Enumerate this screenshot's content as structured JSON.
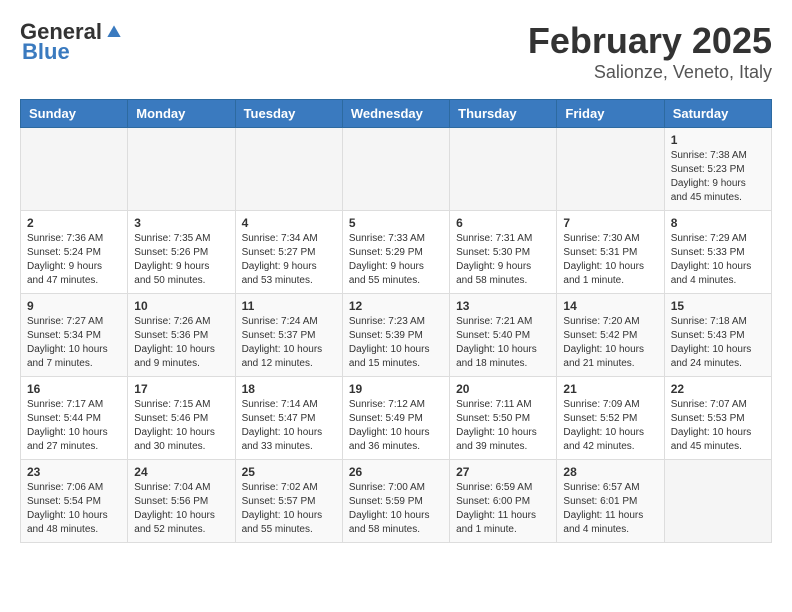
{
  "header": {
    "logo_general": "General",
    "logo_blue": "Blue",
    "month_title": "February 2025",
    "location": "Salionze, Veneto, Italy"
  },
  "days_of_week": [
    "Sunday",
    "Monday",
    "Tuesday",
    "Wednesday",
    "Thursday",
    "Friday",
    "Saturday"
  ],
  "weeks": [
    [
      {
        "day": "",
        "info": ""
      },
      {
        "day": "",
        "info": ""
      },
      {
        "day": "",
        "info": ""
      },
      {
        "day": "",
        "info": ""
      },
      {
        "day": "",
        "info": ""
      },
      {
        "day": "",
        "info": ""
      },
      {
        "day": "1",
        "info": "Sunrise: 7:38 AM\nSunset: 5:23 PM\nDaylight: 9 hours and 45 minutes."
      }
    ],
    [
      {
        "day": "2",
        "info": "Sunrise: 7:36 AM\nSunset: 5:24 PM\nDaylight: 9 hours and 47 minutes."
      },
      {
        "day": "3",
        "info": "Sunrise: 7:35 AM\nSunset: 5:26 PM\nDaylight: 9 hours and 50 minutes."
      },
      {
        "day": "4",
        "info": "Sunrise: 7:34 AM\nSunset: 5:27 PM\nDaylight: 9 hours and 53 minutes."
      },
      {
        "day": "5",
        "info": "Sunrise: 7:33 AM\nSunset: 5:29 PM\nDaylight: 9 hours and 55 minutes."
      },
      {
        "day": "6",
        "info": "Sunrise: 7:31 AM\nSunset: 5:30 PM\nDaylight: 9 hours and 58 minutes."
      },
      {
        "day": "7",
        "info": "Sunrise: 7:30 AM\nSunset: 5:31 PM\nDaylight: 10 hours and 1 minute."
      },
      {
        "day": "8",
        "info": "Sunrise: 7:29 AM\nSunset: 5:33 PM\nDaylight: 10 hours and 4 minutes."
      }
    ],
    [
      {
        "day": "9",
        "info": "Sunrise: 7:27 AM\nSunset: 5:34 PM\nDaylight: 10 hours and 7 minutes."
      },
      {
        "day": "10",
        "info": "Sunrise: 7:26 AM\nSunset: 5:36 PM\nDaylight: 10 hours and 9 minutes."
      },
      {
        "day": "11",
        "info": "Sunrise: 7:24 AM\nSunset: 5:37 PM\nDaylight: 10 hours and 12 minutes."
      },
      {
        "day": "12",
        "info": "Sunrise: 7:23 AM\nSunset: 5:39 PM\nDaylight: 10 hours and 15 minutes."
      },
      {
        "day": "13",
        "info": "Sunrise: 7:21 AM\nSunset: 5:40 PM\nDaylight: 10 hours and 18 minutes."
      },
      {
        "day": "14",
        "info": "Sunrise: 7:20 AM\nSunset: 5:42 PM\nDaylight: 10 hours and 21 minutes."
      },
      {
        "day": "15",
        "info": "Sunrise: 7:18 AM\nSunset: 5:43 PM\nDaylight: 10 hours and 24 minutes."
      }
    ],
    [
      {
        "day": "16",
        "info": "Sunrise: 7:17 AM\nSunset: 5:44 PM\nDaylight: 10 hours and 27 minutes."
      },
      {
        "day": "17",
        "info": "Sunrise: 7:15 AM\nSunset: 5:46 PM\nDaylight: 10 hours and 30 minutes."
      },
      {
        "day": "18",
        "info": "Sunrise: 7:14 AM\nSunset: 5:47 PM\nDaylight: 10 hours and 33 minutes."
      },
      {
        "day": "19",
        "info": "Sunrise: 7:12 AM\nSunset: 5:49 PM\nDaylight: 10 hours and 36 minutes."
      },
      {
        "day": "20",
        "info": "Sunrise: 7:11 AM\nSunset: 5:50 PM\nDaylight: 10 hours and 39 minutes."
      },
      {
        "day": "21",
        "info": "Sunrise: 7:09 AM\nSunset: 5:52 PM\nDaylight: 10 hours and 42 minutes."
      },
      {
        "day": "22",
        "info": "Sunrise: 7:07 AM\nSunset: 5:53 PM\nDaylight: 10 hours and 45 minutes."
      }
    ],
    [
      {
        "day": "23",
        "info": "Sunrise: 7:06 AM\nSunset: 5:54 PM\nDaylight: 10 hours and 48 minutes."
      },
      {
        "day": "24",
        "info": "Sunrise: 7:04 AM\nSunset: 5:56 PM\nDaylight: 10 hours and 52 minutes."
      },
      {
        "day": "25",
        "info": "Sunrise: 7:02 AM\nSunset: 5:57 PM\nDaylight: 10 hours and 55 minutes."
      },
      {
        "day": "26",
        "info": "Sunrise: 7:00 AM\nSunset: 5:59 PM\nDaylight: 10 hours and 58 minutes."
      },
      {
        "day": "27",
        "info": "Sunrise: 6:59 AM\nSunset: 6:00 PM\nDaylight: 11 hours and 1 minute."
      },
      {
        "day": "28",
        "info": "Sunrise: 6:57 AM\nSunset: 6:01 PM\nDaylight: 11 hours and 4 minutes."
      },
      {
        "day": "",
        "info": ""
      }
    ]
  ]
}
